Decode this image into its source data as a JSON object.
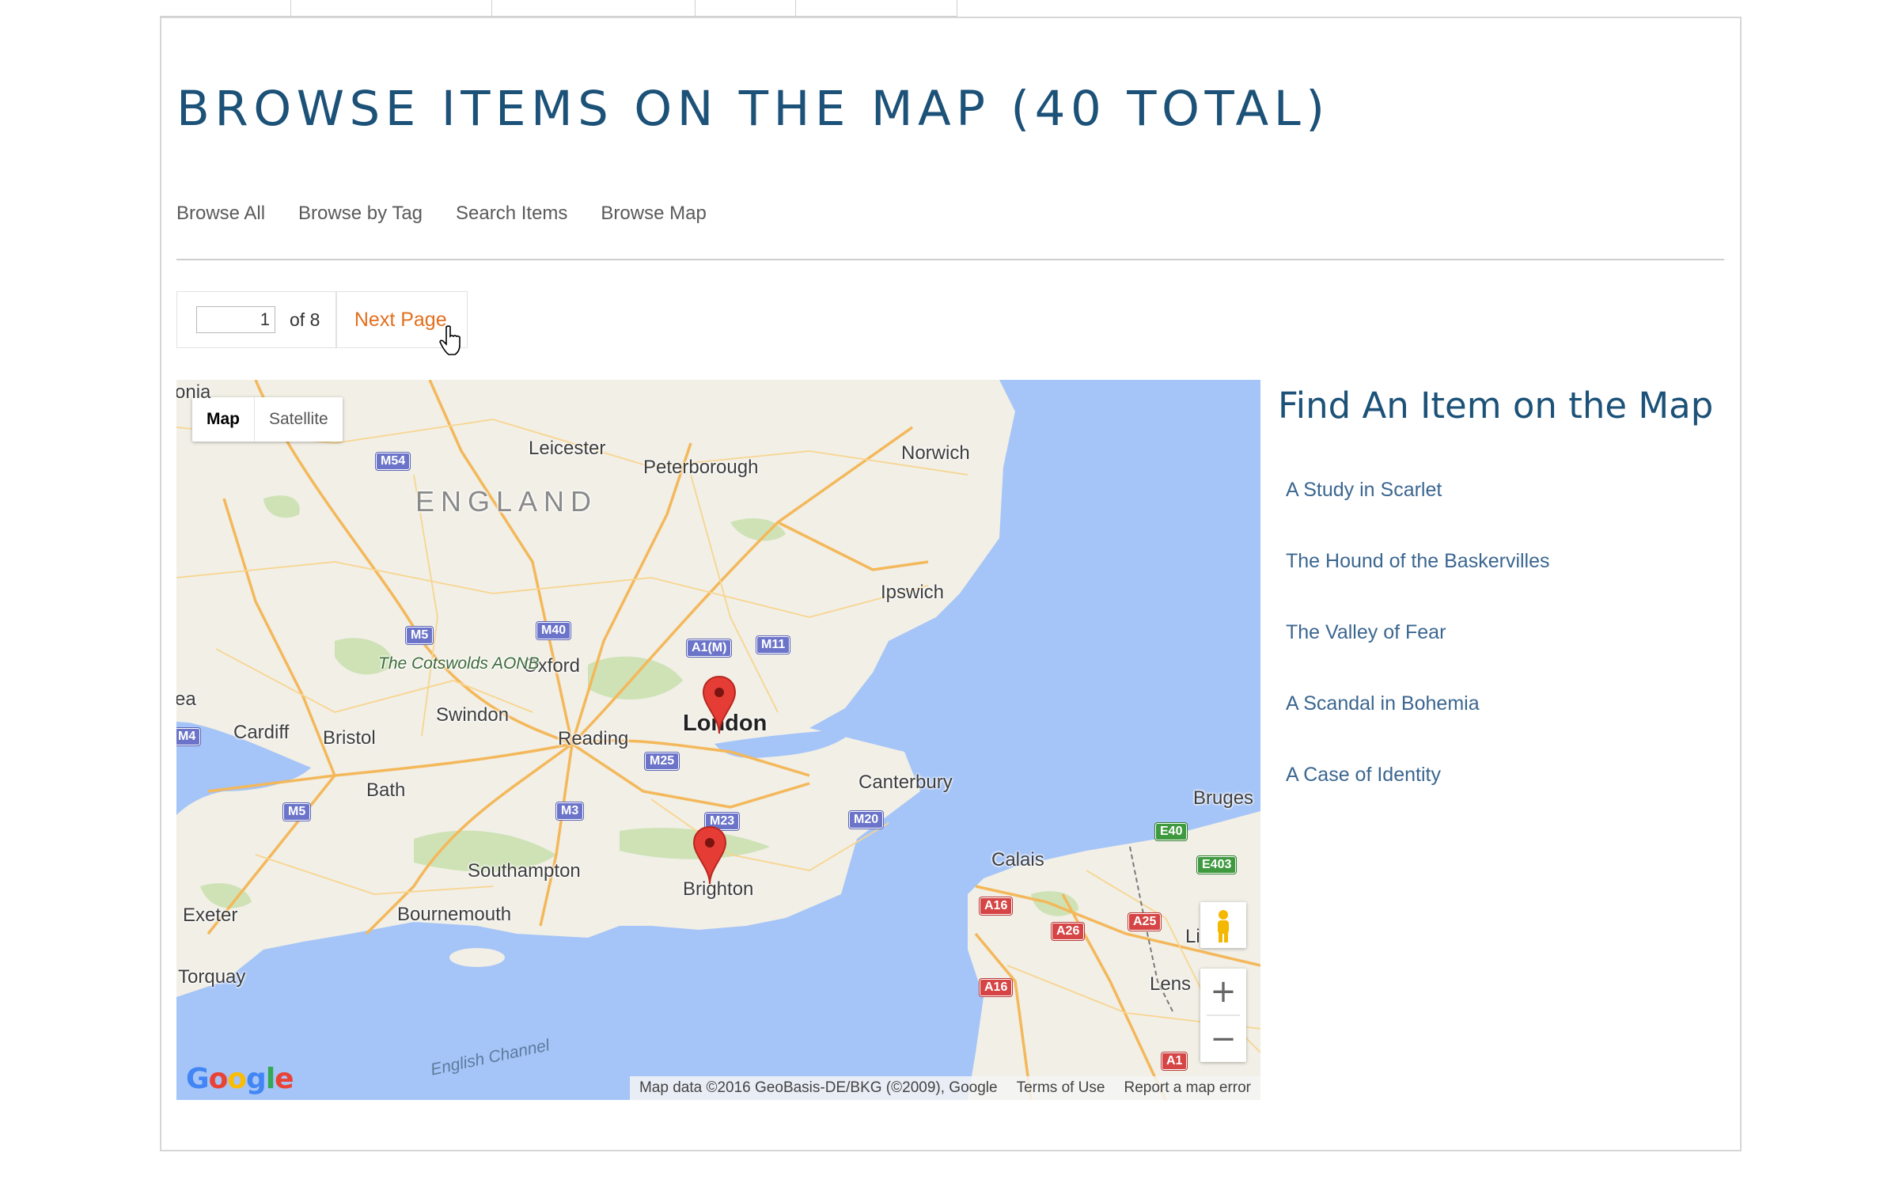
{
  "page": {
    "title": "BROWSE ITEMS ON THE MAP (40 TOTAL)"
  },
  "subnav": [
    "Browse All",
    "Browse by Tag",
    "Search Items",
    "Browse Map"
  ],
  "pagination": {
    "current_page": "1",
    "of_label": "of 8",
    "next_label": "Next Page"
  },
  "map": {
    "type_controls": {
      "map": "Map",
      "satellite": "Satellite"
    },
    "labels": {
      "country": "ENGLAND",
      "leicester": "Leicester",
      "peterborough": "Peterborough",
      "norwich": "Norwich",
      "ipswich": "Ipswich",
      "oxford": "Oxford",
      "cotswolds": "The Cotswolds AONB",
      "swindon": "Swindon",
      "reading": "Reading",
      "london": "London",
      "cardiff": "Cardiff",
      "bristol": "Bristol",
      "bath": "Bath",
      "canterbury": "Canterbury",
      "southampton": "Southampton",
      "bournemouth": "Bournemouth",
      "brighton": "Brighton",
      "exeter": "Exeter",
      "torquay": "Torquay",
      "calais": "Calais",
      "bruges": "Bruges",
      "lens": "Lens",
      "lille": "Li",
      "english_channel": "English Channel",
      "edge_left_top": "onia",
      "edge_left_mid": "ea"
    },
    "roads": {
      "m54": "M54",
      "m5_north": "M5",
      "m40": "M40",
      "a1m": "A1(M)",
      "m11": "M11",
      "m4": "M4",
      "m25": "M25",
      "m5_south": "M5",
      "m3": "M3",
      "m23": "M23",
      "m20": "M20",
      "e40": "E40",
      "e403": "E403",
      "a16_north": "A16",
      "a26": "A26",
      "a25": "A25",
      "a16_south": "A16",
      "a1_fr": "A1"
    },
    "google_logo": "Google",
    "attribution": {
      "data": "Map data ©2016 GeoBasis-DE/BKG (©2009), Google",
      "terms": "Terms of Use",
      "report": "Report a map error"
    },
    "zoom_in": "+",
    "zoom_out": "−",
    "colors": {
      "land": "#f1efe6",
      "water": "#a5c4f7",
      "park": "#cfe2b6",
      "road": "#f4b85b",
      "marker": "#e53d35"
    }
  },
  "sidebar": {
    "title": "Find An Item on the Map",
    "items": [
      "A Study in Scarlet",
      "The Hound of the Baskervilles",
      "The Valley of Fear",
      "A Scandal in Bohemia",
      "A Case of Identity"
    ]
  },
  "colors": {
    "title": "#1c5178",
    "link": "#3b6690",
    "next_page": "#e36f1e"
  }
}
